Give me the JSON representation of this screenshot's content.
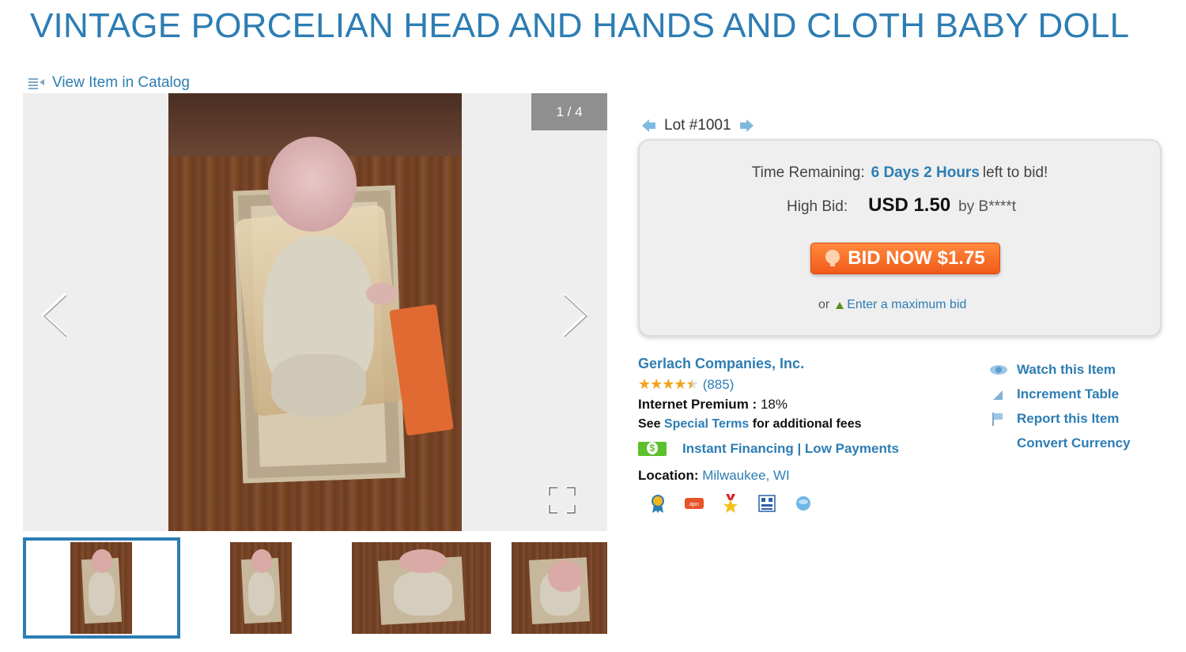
{
  "title": "VINTAGE PORCELIAN HEAD AND HANDS AND CLOTH BABY DOLL",
  "catalog_link": "View Item in Catalog",
  "gallery": {
    "counter": "1 / 4",
    "prev_icon": "chevron-left-icon",
    "next_icon": "chevron-right-icon",
    "fullscreen_icon": "fullscreen-icon",
    "thumbnail_count": 4
  },
  "lot": {
    "label": "Lot #1001"
  },
  "bid_box": {
    "time_label": "Time Remaining:",
    "time_value": "6 Days 2 Hours",
    "time_suffix": "left to bid!",
    "high_bid_label": "High Bid:",
    "high_bid_amount": "USD 1.50",
    "high_bid_by": "by B****t",
    "bid_button": "BID NOW $1.75",
    "or_text": "or",
    "max_bid_link": "Enter a maximum bid"
  },
  "seller": {
    "name": "Gerlach Companies, Inc.",
    "stars": "★★★★★",
    "rating": 4.5,
    "reviews": "(885)",
    "premium_label": "Internet Premium :",
    "premium_value": "18%",
    "terms_prefix": "See",
    "terms_link": "Special Terms",
    "terms_suffix": "for additional fees",
    "financing": "Instant Financing | Low Payments",
    "location_label": "Location:",
    "location_value": "Milwaukee, WI",
    "badges": [
      "ribbon-badge-icon",
      "apn-badge-icon",
      "star-medal-icon",
      "building-badge-icon",
      "globe-badge-icon"
    ]
  },
  "actions": {
    "watch": "Watch this Item",
    "increment": "Increment Table",
    "report": "Report this Item",
    "currency": "Convert Currency"
  },
  "colors": {
    "accent": "#2d7db3",
    "bid_button": "#f15a1a",
    "stars": "#f2a31b",
    "financing_green": "#5cc12b"
  }
}
